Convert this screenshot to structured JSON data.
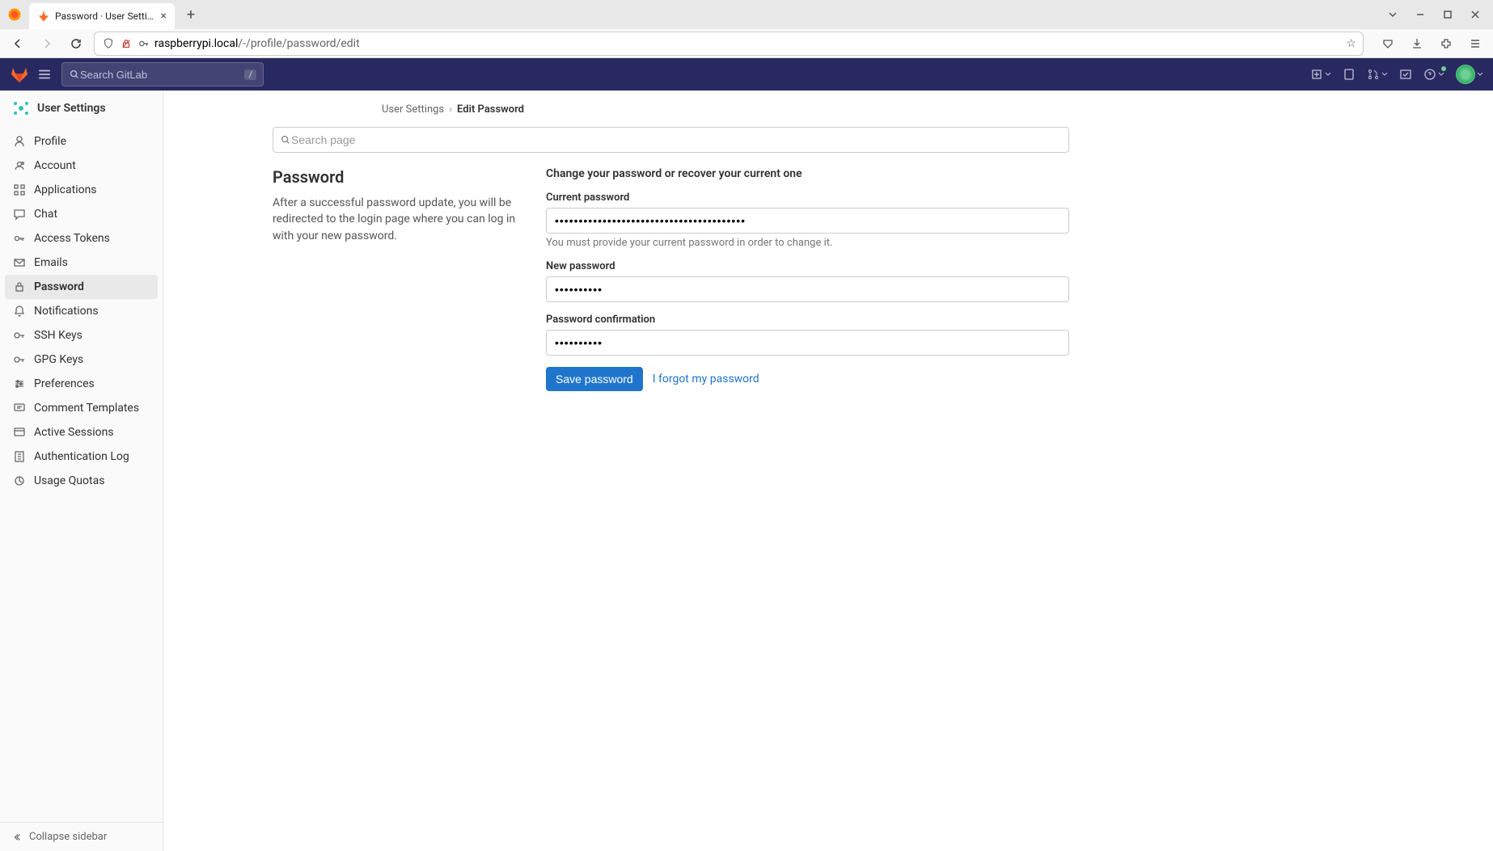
{
  "browser": {
    "tab_title": "Password · User Settings",
    "url_host": "raspberrypi.local",
    "url_path": "/-/profile/password/edit"
  },
  "topbar": {
    "search_placeholder": "Search GitLab",
    "search_shortcut": "/"
  },
  "sidebar": {
    "header": "User Settings",
    "items": [
      {
        "label": "Profile",
        "icon": "user-icon"
      },
      {
        "label": "Account",
        "icon": "account-icon"
      },
      {
        "label": "Applications",
        "icon": "apps-icon"
      },
      {
        "label": "Chat",
        "icon": "chat-icon"
      },
      {
        "label": "Access Tokens",
        "icon": "token-icon"
      },
      {
        "label": "Emails",
        "icon": "mail-icon"
      },
      {
        "label": "Password",
        "icon": "lock-icon"
      },
      {
        "label": "Notifications",
        "icon": "bell-icon"
      },
      {
        "label": "SSH Keys",
        "icon": "key-icon"
      },
      {
        "label": "GPG Keys",
        "icon": "key-icon"
      },
      {
        "label": "Preferences",
        "icon": "sliders-icon"
      },
      {
        "label": "Comment Templates",
        "icon": "comment-icon"
      },
      {
        "label": "Active Sessions",
        "icon": "session-icon"
      },
      {
        "label": "Authentication Log",
        "icon": "log-icon"
      },
      {
        "label": "Usage Quotas",
        "icon": "quota-icon"
      }
    ],
    "active_index": 6,
    "collapse_label": "Collapse sidebar"
  },
  "breadcrumbs": {
    "root": "User Settings",
    "current": "Edit Password"
  },
  "search_page": {
    "placeholder": "Search page"
  },
  "page": {
    "title": "Password",
    "description": "After a successful password update, you will be redirected to the login page where you can log in with your new password.",
    "form_title": "Change your password or recover your current one",
    "fields": {
      "current": {
        "label": "Current password",
        "value": "••••••••••••••••••••••••••••••••••••••••",
        "help": "You must provide your current password in order to change it."
      },
      "new": {
        "label": "New password",
        "value": "••••••••••"
      },
      "confirm": {
        "label": "Password confirmation",
        "value": "••••••••••"
      }
    },
    "save_label": "Save password",
    "forgot_label": "I forgot my password"
  }
}
